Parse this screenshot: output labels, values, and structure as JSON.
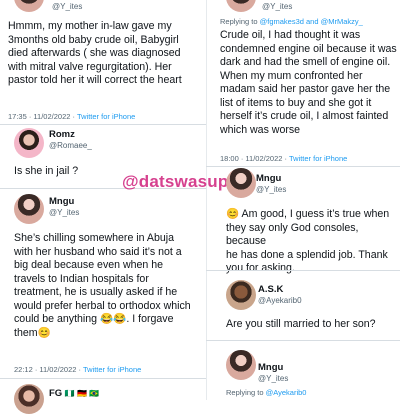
{
  "left": {
    "t1": {
      "handle": "@Y_ites",
      "lines": [
        "Hmmm, my mother in-law gave my",
        "3months old baby crude oil, Babygirl",
        "died afterwards ( she was diagnosed",
        "with mitral valve regurgitation). Her",
        "pastor told her it will correct the heart"
      ],
      "time": "17:35 · 11/02/2022 ·",
      "source": "Twitter for iPhone"
    },
    "t2": {
      "name": "Romz",
      "handle": "@Romaee_",
      "text": "Is she in jail ?"
    },
    "t3": {
      "name": "Mngu",
      "handle": "@Y_ites",
      "lines": [
        "She’s chilling somewhere in Abuja",
        "with her husband who said it’s not a",
        "big deal because even when he",
        "travels to Indian hospitals for",
        "treatment, he is usually asked if he",
        "would prefer herbal to orthodox which",
        "could be anything 😂😂. I forgave",
        "them😊"
      ],
      "time": "22:12 · 11/02/2022 ·",
      "source": "Twitter for iPhone"
    },
    "t4": {
      "name": "FG",
      "flags": "🇳🇬 🇩🇪 🇧🇷"
    }
  },
  "right": {
    "t1": {
      "handle": "@Y_ites",
      "reply_prefix": "Replying to",
      "reply_to": "@fgmakes3d and @MrMakzy_",
      "lines": [
        "Crude oil, I had thought it was",
        "condemned engine oil because it was",
        "dark and had the smell of engine oil.",
        "When my mum confronted her",
        "madam said her pastor gave her the",
        "list of items to buy and she got it",
        "herself it’s crude oil, I almost fainted",
        "which was worse"
      ],
      "time": "18:00 · 11/02/2022 ·",
      "source": "Twitter for iPhone"
    },
    "t2": {
      "name": "Mngu",
      "handle": "@Y_ites",
      "lines": [
        "😊 Am good, I guess it’s true when",
        "they say only God consoles, because",
        "he has done a splendid job. Thank",
        "you for asking."
      ]
    },
    "t3": {
      "name": "A.S.K",
      "handle": "@Ayekarib0",
      "text": "Are you still married to her son?"
    },
    "t4": {
      "name": "Mngu",
      "handle": "@Y_ites",
      "reply_prefix": "Replying to",
      "reply_to": "@Ayekarib0"
    }
  },
  "watermark": "@datswasup",
  "colors": {
    "link": "#1d9bf0",
    "watermark": "#d6418f",
    "divider": "#d7dde2"
  }
}
